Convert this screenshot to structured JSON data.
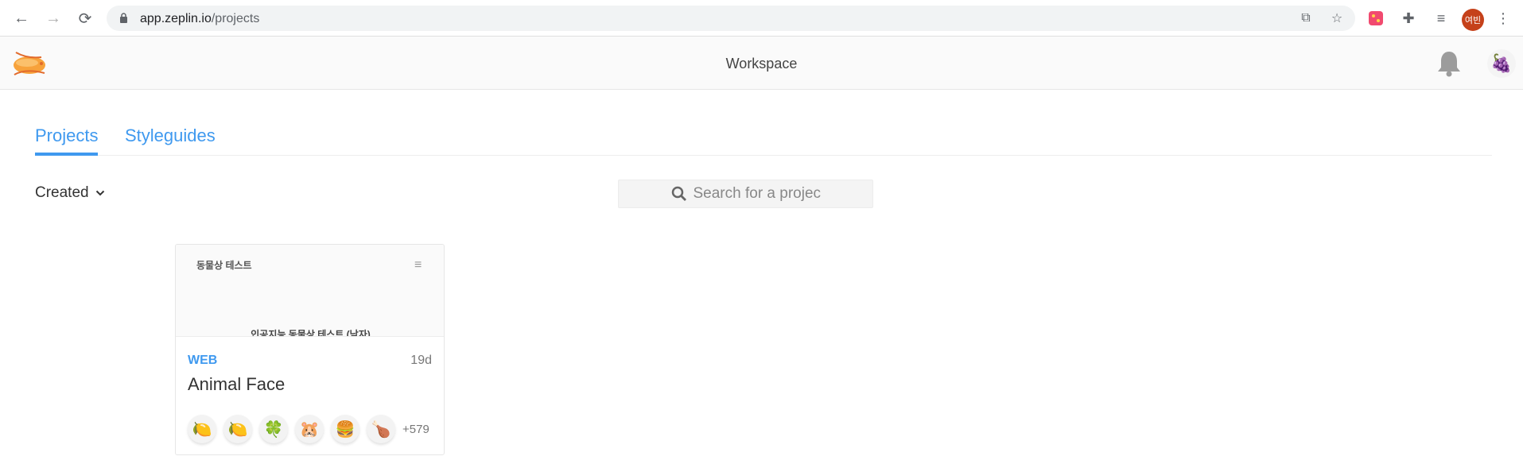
{
  "browser": {
    "url_host": "app.zeplin.io",
    "url_path": "/projects",
    "profile_label": "여빈"
  },
  "header": {
    "title": "Workspace"
  },
  "tabs": [
    {
      "label": "Projects",
      "active": true
    },
    {
      "label": "Styleguides",
      "active": false
    }
  ],
  "filter": {
    "sort_label": "Created"
  },
  "search": {
    "placeholder": "Search for a project"
  },
  "projects": [
    {
      "thumb_title": "동물상 테스트",
      "thumb_subtitle": "인공지능 동물상 테스트 (남자)",
      "platform": "WEB",
      "age": "19d",
      "name": "Animal Face",
      "members": [
        "🍋",
        "🍋",
        "🍀",
        "🐹",
        "🍔",
        "🍗"
      ],
      "more_members": "+579"
    }
  ],
  "colors": {
    "accent": "#3f99ef",
    "logo": "#f7a23b",
    "profile": "#c5411a"
  },
  "icons": [
    "back-icon",
    "forward-icon",
    "reload-icon",
    "lock-icon",
    "translate-icon",
    "star-icon",
    "extension-icon",
    "puzzle-icon",
    "media-icon",
    "menu-icon",
    "zeplin-logo",
    "bell-icon",
    "search-icon",
    "chevron-down-icon",
    "hamburger-icon"
  ]
}
